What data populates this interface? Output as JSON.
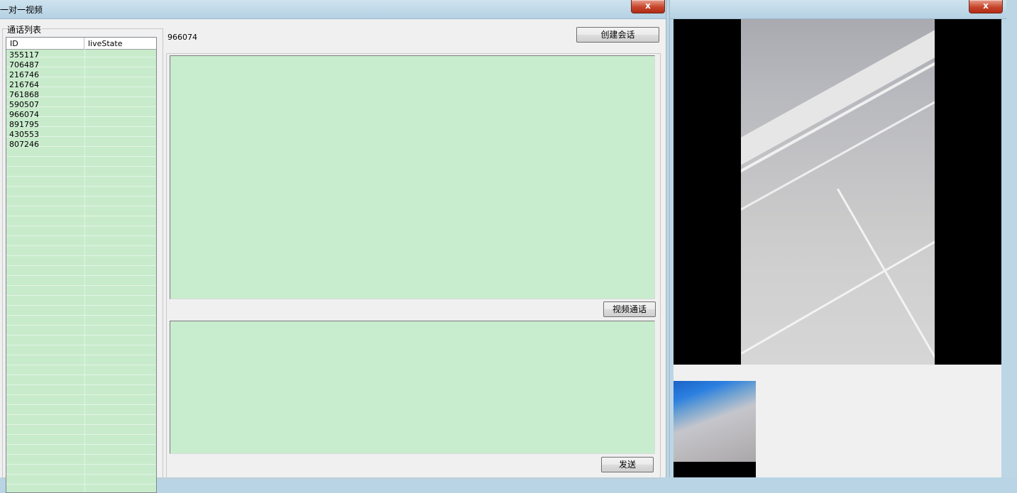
{
  "main_window": {
    "title": "一对一视频",
    "close_label": "x",
    "group_title": "通话列表",
    "list": {
      "columns": [
        "ID",
        "liveState"
      ],
      "rows": [
        {
          "id": "355117",
          "state": ""
        },
        {
          "id": "706487",
          "state": ""
        },
        {
          "id": "216746",
          "state": ""
        },
        {
          "id": "216764",
          "state": ""
        },
        {
          "id": "761868",
          "state": ""
        },
        {
          "id": "590507",
          "state": ""
        },
        {
          "id": "966074",
          "state": ""
        },
        {
          "id": "891795",
          "state": ""
        },
        {
          "id": "430553",
          "state": ""
        },
        {
          "id": "807246",
          "state": ""
        }
      ]
    },
    "current_id": "966074",
    "create_session_label": "创建会话",
    "video_call_label": "视频通话",
    "send_label": "发送",
    "message_text": "",
    "input_text": ""
  },
  "video_window": {
    "close_label": "x"
  },
  "colors": {
    "list_background": "#c8ebcc",
    "text_area_background": "#c8ecce",
    "close_button": "#c6462c"
  }
}
